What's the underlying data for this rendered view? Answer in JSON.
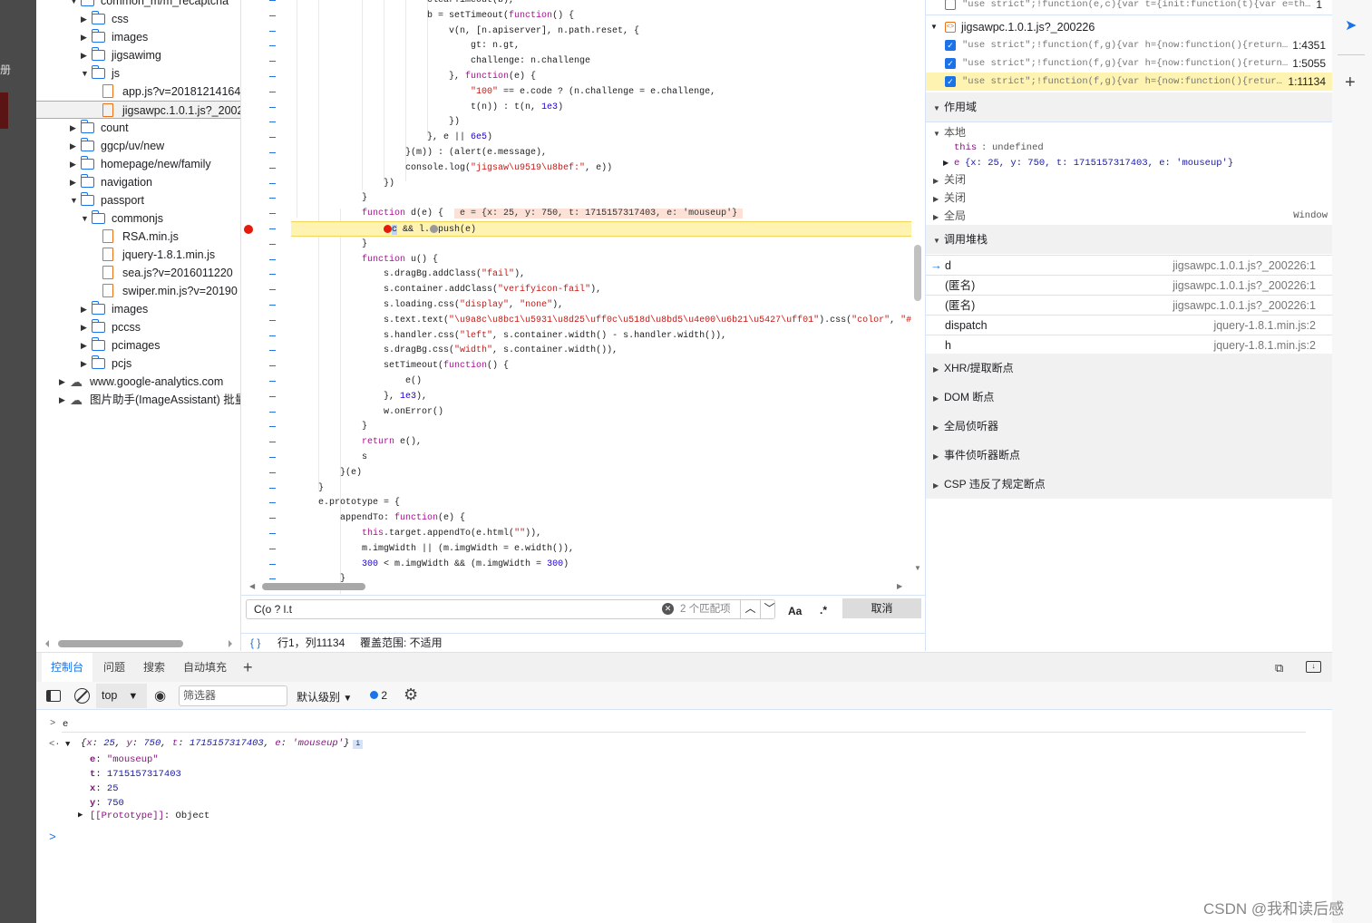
{
  "background_page": {
    "fragment": "册"
  },
  "tree": [
    {
      "d": 1,
      "t": "folder",
      "a": "open",
      "l": "common_m/m_recaptcha"
    },
    {
      "d": 2,
      "t": "folder",
      "a": "closed",
      "l": "css"
    },
    {
      "d": 2,
      "t": "folder",
      "a": "closed",
      "l": "images"
    },
    {
      "d": 2,
      "t": "folder",
      "a": "closed",
      "l": "jigsawimg"
    },
    {
      "d": 2,
      "t": "folder",
      "a": "open",
      "l": "js"
    },
    {
      "d": 3,
      "t": "file",
      "a": "",
      "l": "app.js?v=20181214164"
    },
    {
      "d": 3,
      "t": "file",
      "a": "",
      "l": "jigsawpc.1.0.1.js?_2002",
      "selected": true
    },
    {
      "d": 1,
      "t": "folder",
      "a": "closed",
      "l": "count"
    },
    {
      "d": 1,
      "t": "folder",
      "a": "closed",
      "l": "ggcp/uv/new"
    },
    {
      "d": 1,
      "t": "folder",
      "a": "closed",
      "l": "homepage/new/family"
    },
    {
      "d": 1,
      "t": "folder",
      "a": "closed",
      "l": "navigation"
    },
    {
      "d": 1,
      "t": "folder",
      "a": "open",
      "l": "passport"
    },
    {
      "d": 2,
      "t": "folder",
      "a": "open",
      "l": "commonjs"
    },
    {
      "d": 3,
      "t": "file",
      "a": "",
      "l": "RSA.min.js"
    },
    {
      "d": 3,
      "t": "file",
      "a": "",
      "l": "jquery-1.8.1.min.js"
    },
    {
      "d": 3,
      "t": "file",
      "a": "",
      "l": "sea.js?v=2016011220"
    },
    {
      "d": 3,
      "t": "file",
      "a": "",
      "l": "swiper.min.js?v=20190"
    },
    {
      "d": 2,
      "t": "folder",
      "a": "closed",
      "l": "images"
    },
    {
      "d": 2,
      "t": "folder",
      "a": "closed",
      "l": "pccss"
    },
    {
      "d": 2,
      "t": "folder",
      "a": "closed",
      "l": "pcimages"
    },
    {
      "d": 2,
      "t": "folder",
      "a": "closed",
      "l": "pcjs"
    },
    {
      "d": 0,
      "t": "cloud",
      "a": "closed",
      "l": "www.google-analytics.com"
    },
    {
      "d": 0,
      "t": "cloud",
      "a": "closed",
      "l": "图片助手(ImageAssistant) 批量"
    }
  ],
  "code": [
    [
      [
        "",
        "                        clearTimeout(b),"
      ]
    ],
    [
      [
        "",
        "                        b = setTimeout("
      ],
      [
        "kw",
        "function"
      ],
      [
        "",
        "() {"
      ]
    ],
    [
      [
        "",
        "                            v(n, [n.apiserver], n.path.reset, {"
      ]
    ],
    [
      [
        "",
        "                                gt: n.gt,"
      ]
    ],
    [
      [
        "",
        "                                challenge: n.challenge"
      ]
    ],
    [
      [
        "",
        "                            }, "
      ],
      [
        "kw",
        "function"
      ],
      [
        "",
        "(e) {"
      ]
    ],
    [
      [
        "",
        "                                "
      ],
      [
        "str",
        "\"100\""
      ],
      [
        "",
        " == e.code ? (n.challenge = e.challenge,"
      ]
    ],
    [
      [
        "",
        "                                t(n)) : t(n, "
      ],
      [
        "num",
        "1e3"
      ],
      [
        "",
        ")"
      ]
    ],
    [
      [
        "",
        "                            })"
      ]
    ],
    [
      [
        "",
        "                        }, e || "
      ],
      [
        "num",
        "6e5"
      ],
      [
        "",
        ")"
      ]
    ],
    [
      [
        "",
        "                    }(m)) : (alert(e.message),"
      ]
    ],
    [
      [
        "",
        "                    console.log("
      ],
      [
        "str",
        "\"jigsaw\\u9519\\u8bef:\""
      ],
      [
        "",
        ", e))"
      ]
    ],
    [
      [
        "",
        "                })"
      ]
    ],
    [
      [
        "",
        "            }"
      ]
    ],
    [
      [
        "",
        "            "
      ],
      [
        "kw",
        "function"
      ],
      [
        "",
        " d(e) {  "
      ],
      [
        "inl",
        " e = {x: 25, y: 750, t: 1715157317403, e: 'mouseup'} "
      ]
    ],
    [
      [
        "",
        "                "
      ],
      [
        "bpc",
        "c"
      ],
      [
        "",
        " && l."
      ],
      [
        "bpd",
        "push(e)"
      ]
    ],
    [
      [
        "",
        "            }"
      ]
    ],
    [
      [
        "",
        "            "
      ],
      [
        "kw",
        "function"
      ],
      [
        "",
        " u() {"
      ]
    ],
    [
      [
        "",
        "                s.dragBg.addClass("
      ],
      [
        "str",
        "\"fail\""
      ],
      [
        "",
        "),"
      ]
    ],
    [
      [
        "",
        "                s.container.addClass("
      ],
      [
        "str",
        "\"verifyicon-fail\""
      ],
      [
        "",
        "),"
      ]
    ],
    [
      [
        "",
        "                s.loading.css("
      ],
      [
        "str",
        "\"display\""
      ],
      [
        "",
        ", "
      ],
      [
        "str",
        "\"none\""
      ],
      [
        "",
        "),"
      ]
    ],
    [
      [
        "",
        "                s.text.text("
      ],
      [
        "str",
        "\"\\u9a8c\\u8bc1\\u5931\\u8d25\\uff0c\\u518d\\u8bd5\\u4e00\\u6b21\\u5427\\uff01\""
      ],
      [
        "",
        ").css("
      ],
      [
        "str",
        "\"color\""
      ],
      [
        "",
        ", "
      ],
      [
        "str",
        "\"#"
      ]
    ],
    [
      [
        "",
        "                s.handler.css("
      ],
      [
        "str",
        "\"left\""
      ],
      [
        "",
        ", s.container.width() - s.handler.width()),"
      ]
    ],
    [
      [
        "",
        "                s.dragBg.css("
      ],
      [
        "str",
        "\"width\""
      ],
      [
        "",
        ", s.container.width()),"
      ]
    ],
    [
      [
        "",
        "                setTimeout("
      ],
      [
        "kw",
        "function"
      ],
      [
        "",
        "() {"
      ]
    ],
    [
      [
        "",
        "                    e()"
      ]
    ],
    [
      [
        "",
        "                }, "
      ],
      [
        "num",
        "1e3"
      ],
      [
        "",
        "),"
      ]
    ],
    [
      [
        "",
        "                w.onError()"
      ]
    ],
    [
      [
        "",
        "            }"
      ]
    ],
    [
      [
        "",
        "            "
      ],
      [
        "kw",
        "return"
      ],
      [
        "",
        " e(),"
      ]
    ],
    [
      [
        "",
        "            s"
      ]
    ],
    [
      [
        "",
        "        }(e)"
      ]
    ],
    [
      [
        "",
        "    }"
      ]
    ],
    [
      [
        "",
        "    e.prototype = {"
      ]
    ],
    [
      [
        "",
        "        appendTo: "
      ],
      [
        "kw",
        "function"
      ],
      [
        "",
        "(e) {"
      ]
    ],
    [
      [
        "",
        "            "
      ],
      [
        "kw",
        "this"
      ],
      [
        "",
        ".target.appendTo(e.html("
      ],
      [
        "str",
        "\"\""
      ],
      [
        "",
        ")),"
      ]
    ],
    [
      [
        "",
        "            m.imgWidth || (m.imgWidth = e.width()),"
      ]
    ],
    [
      [
        "",
        "            "
      ],
      [
        "num",
        "300"
      ],
      [
        "",
        " < m.imgWidth && (m.imgWidth = "
      ],
      [
        "num",
        "300"
      ],
      [
        "",
        ")"
      ]
    ],
    [
      [
        "",
        "        }"
      ]
    ]
  ],
  "paused_line_index": 15,
  "breakpoint_line_index": 15,
  "search": {
    "value": "C(o ? l.t",
    "matches": "2 个匹配项",
    "case_label": "Aa",
    "regex_label": ".*",
    "cancel": "取消"
  },
  "status": {
    "braces": "{ }",
    "position": "行1，列11134",
    "coverage": "覆盖范围: 不适用"
  },
  "breakpoints": {
    "top_item": {
      "code": "\"use strict\";!function(e,c){var t={init:function(t){var e=th…",
      "line": "1",
      "checked": false
    },
    "file": "jigsawpc.1.0.1.js?_200226",
    "items": [
      {
        "code": "\"use strict\";!function(f,g){var h={now:function(){return…",
        "line": "1:4351",
        "checked": true
      },
      {
        "code": "\"use strict\";!function(f,g){var h={now:function(){return…",
        "line": "1:5055",
        "checked": true
      },
      {
        "code": "\"use strict\";!function(f,g){var h={now:function(){retur…",
        "line": "1:11134",
        "checked": true,
        "active": true
      }
    ]
  },
  "scope": {
    "title": "作用域",
    "local": "本地",
    "this_key": "this",
    "this_val": "undefined",
    "e_key": "e",
    "e_val": "{x: 25, y: 750, t: 1715157317403, e: 'mouseup'}",
    "closures": [
      "关闭",
      "关闭"
    ],
    "global": "全局",
    "global_val": "Window"
  },
  "callstack": {
    "title": "调用堆栈",
    "frames": [
      {
        "name": "d",
        "loc": "jigsawpc.1.0.1.js?_200226:1",
        "current": true
      },
      {
        "name": "(匿名)",
        "loc": "jigsawpc.1.0.1.js?_200226:1"
      },
      {
        "name": "(匿名)",
        "loc": "jigsawpc.1.0.1.js?_200226:1"
      },
      {
        "name": "dispatch",
        "loc": "jquery-1.8.1.min.js:2"
      },
      {
        "name": "h",
        "loc": "jquery-1.8.1.min.js:2"
      }
    ]
  },
  "sections": [
    "XHR/提取断点",
    "DOM 断点",
    "全局侦听器",
    "事件侦听器断点",
    "CSP 违反了规定断点"
  ],
  "drawer": {
    "tabs": [
      "控制台",
      "问题",
      "搜索",
      "自动填充"
    ],
    "active": 0
  },
  "console_toolbar": {
    "context": "top",
    "filter_placeholder": "筛选器",
    "level": "默认级别",
    "issues": "2"
  },
  "console": {
    "input": "e",
    "summary": [
      [
        "pk",
        "x"
      ],
      [
        "",
        ": "
      ],
      [
        "pv",
        "25"
      ],
      [
        "",
        ", "
      ],
      [
        "pk",
        "y"
      ],
      [
        "",
        ": "
      ],
      [
        "pv",
        "750"
      ],
      [
        "",
        ", "
      ],
      [
        "pk",
        "t"
      ],
      [
        "",
        ": "
      ],
      [
        "pv",
        "1715157317403"
      ],
      [
        "",
        ", "
      ],
      [
        "pk",
        "e"
      ],
      [
        "",
        ": "
      ],
      [
        "str",
        "'mouseup'"
      ]
    ],
    "props": [
      {
        "k": "e",
        "v": "\"mouseup\"",
        "c": "str"
      },
      {
        "k": "t",
        "v": "1715157317403",
        "c": "pv"
      },
      {
        "k": "x",
        "v": "25",
        "c": "pv"
      },
      {
        "k": "y",
        "v": "750",
        "c": "pv"
      }
    ],
    "proto_key": "[[Prototype]]",
    "proto_val": "Object"
  },
  "watermark": "CSDN @我和读后感",
  "colors": {
    "accent": "#1a73e8",
    "paused_line": "#fef3b0",
    "breakpoint": "#e41b0b"
  }
}
